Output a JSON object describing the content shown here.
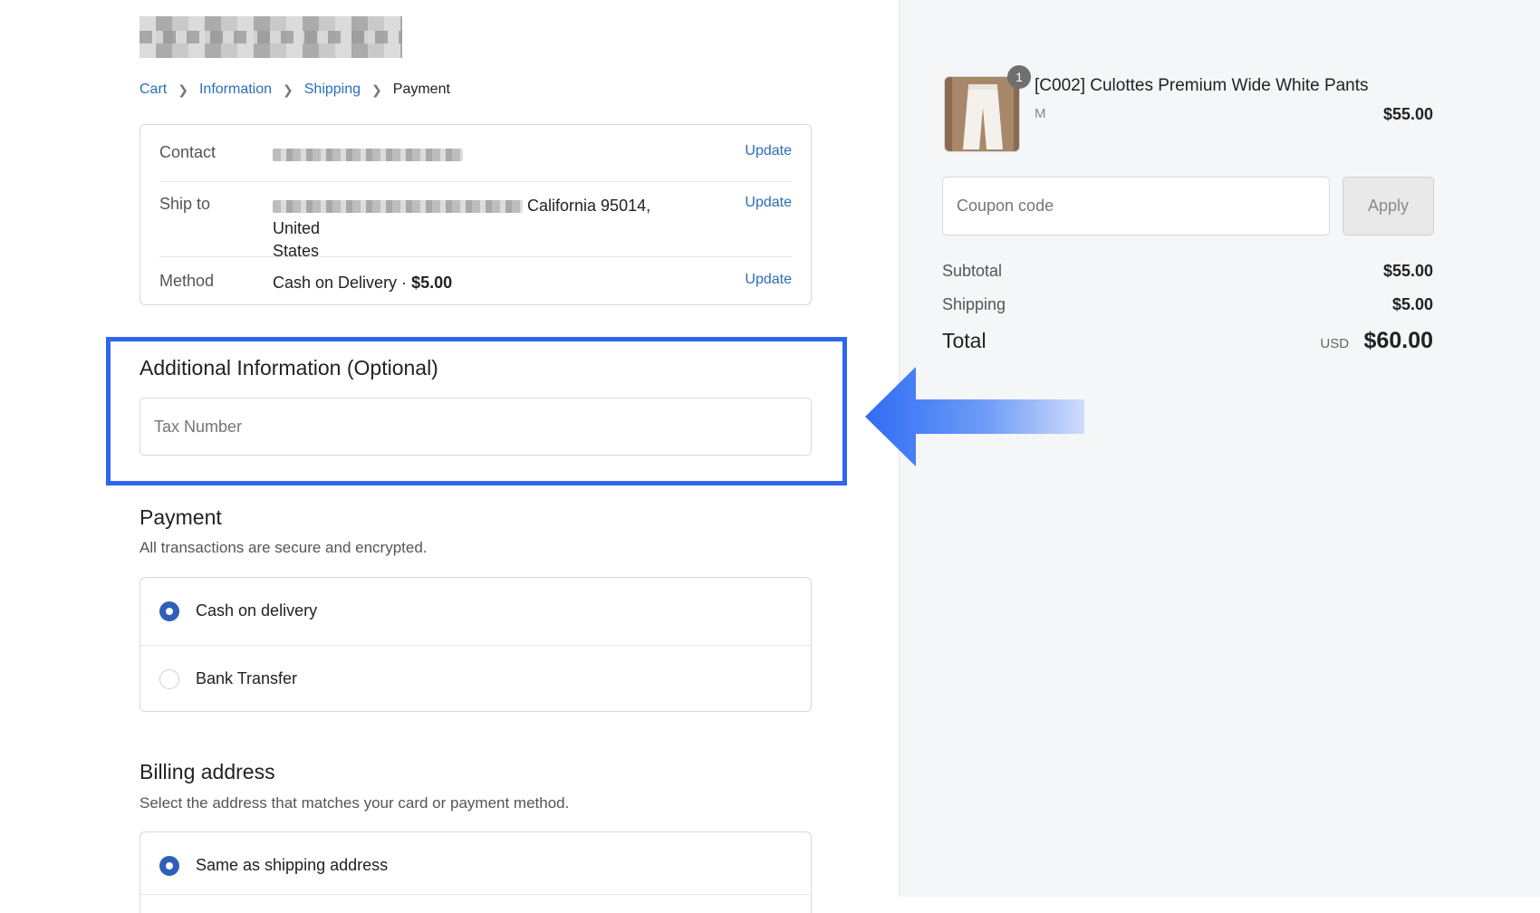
{
  "breadcrumb": {
    "items": [
      {
        "label": "Cart"
      },
      {
        "label": "Information"
      },
      {
        "label": "Shipping"
      },
      {
        "label": "Payment"
      }
    ]
  },
  "review": {
    "contact": {
      "label": "Contact",
      "update": "Update"
    },
    "ship_to": {
      "label": "Ship to",
      "value_visible": "California 95014, United",
      "value_line2": "States",
      "update": "Update"
    },
    "method": {
      "label": "Method",
      "value": "Cash on Delivery · ",
      "price": "$5.00",
      "update": "Update"
    }
  },
  "additional_info": {
    "title": "Additional Information (Optional)",
    "tax_placeholder": "Tax Number"
  },
  "payment": {
    "title": "Payment",
    "subtitle": "All transactions are secure and encrypted.",
    "options": [
      {
        "label": "Cash on delivery",
        "selected": true
      },
      {
        "label": "Bank Transfer",
        "selected": false
      }
    ]
  },
  "billing": {
    "title": "Billing address",
    "subtitle": "Select the address that matches your card or payment method.",
    "options": [
      {
        "label": "Same as shipping address",
        "selected": true
      }
    ]
  },
  "summary": {
    "product": {
      "quantity": "1",
      "name": "[C002] Culottes Premium Wide White Pants",
      "variant": "M",
      "price": "$55.00"
    },
    "coupon": {
      "placeholder": "Coupon code",
      "apply": "Apply"
    },
    "subtotal": {
      "label": "Subtotal",
      "value": "$55.00"
    },
    "shipping": {
      "label": "Shipping",
      "value": "$5.00"
    },
    "total": {
      "label": "Total",
      "currency": "USD",
      "value": "$60.00"
    }
  },
  "colors": {
    "accent_link": "#2a6ebb",
    "highlight_border": "#2f66f0",
    "radio_selected": "#2f5fb8"
  }
}
